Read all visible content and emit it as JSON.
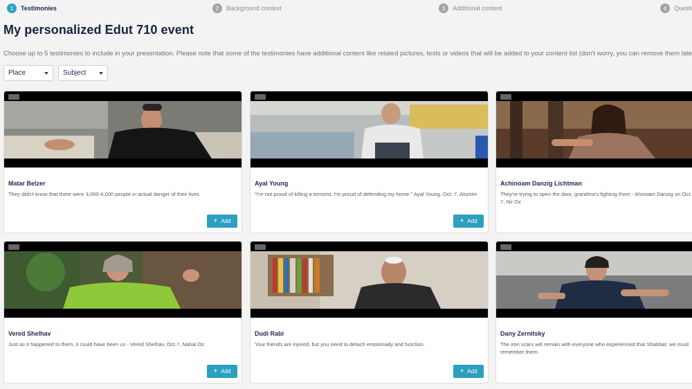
{
  "stepper": {
    "steps": [
      {
        "number": "1",
        "label": "Testimonies",
        "active": true
      },
      {
        "number": "2",
        "label": "Background context",
        "active": false
      },
      {
        "number": "3",
        "label": "Additional content",
        "active": false
      },
      {
        "number": "4",
        "label": "Questi",
        "active": false
      }
    ]
  },
  "page": {
    "title": "My personalized Edut 710 event",
    "subtitle": "Choose up to 5 testimonies to include in your presentation. Please note that some of the testimonies have additional content like related pictures, texts or videos that will be added to your content list (don't worry, you can remove them later)"
  },
  "filters": {
    "place": {
      "label": "Place",
      "icon": "chevron-down-icon"
    },
    "subject": {
      "label": "Subject",
      "icon": "chevron-down-icon"
    }
  },
  "add_label": "Add",
  "cards": [
    {
      "name": "Matar Belzer",
      "description": "They didn't know that there were 3,000-4,000 people in actual danger of their lives"
    },
    {
      "name": "Ayal Young",
      "description": "\"I'm not proud of killing a terrorist, I'm proud of defending my home.\" Ayal Young, Oct. 7, Alumim"
    },
    {
      "name": "Achinoam Danzig Lichtman",
      "description": "They're trying to open the door, grandma's fighting them - Ahinoam Danzig on Oct. 7, Nir Oz"
    },
    {
      "name": "Vered Shelhav",
      "description": "Just as it happened to them, it could have been us - Vered Shelhav, Oct.7, Nahal Oz"
    },
    {
      "name": "Dudi Rabi",
      "description": "Your friends are injured, but you need to detach emotionally and function."
    },
    {
      "name": "Dany Zernitsky",
      "description": "The iron scars will remain with everyone who experienced that Shabbat; we must remember them."
    }
  ]
}
